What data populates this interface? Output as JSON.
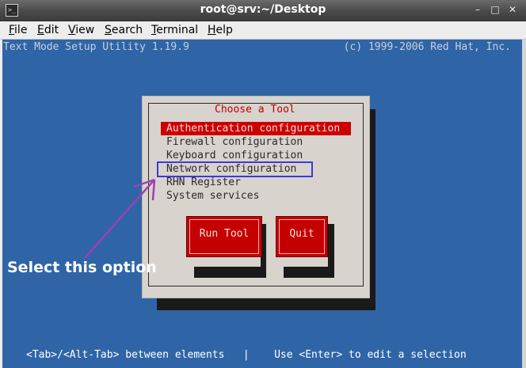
{
  "window": {
    "title": "root@srv:~/Desktop"
  },
  "menubar": {
    "items": [
      {
        "mnemonic": "F",
        "rest": "ile"
      },
      {
        "mnemonic": "E",
        "rest": "dit"
      },
      {
        "mnemonic": "V",
        "rest": "iew"
      },
      {
        "mnemonic": "S",
        "rest": "earch"
      },
      {
        "mnemonic": "T",
        "rest": "erminal"
      },
      {
        "mnemonic": "H",
        "rest": "elp"
      }
    ]
  },
  "terminal": {
    "header_left": "Text Mode Setup Utility 1.19.9",
    "header_right": "(c) 1999-2006 Red Hat, Inc.",
    "footer": "<Tab>/<Alt-Tab> between elements   |    Use <Enter> to edit a selection"
  },
  "dialog": {
    "title": "Choose a Tool",
    "items": [
      "Authentication configuration",
      "Firewall configuration",
      "Keyboard configuration",
      "Network configuration",
      "RHN Register",
      "System services"
    ],
    "selected_item": "Authentication configuration",
    "run_button": "Run Tool",
    "quit_button": "Quit"
  },
  "annotation": {
    "text": "Select this option",
    "highlight_color": "#3b3bd8",
    "arrow_color": "#a040b0"
  },
  "colors": {
    "terminal_bg": "#2f65a6",
    "dialog_bg": "#d8d3cd",
    "accent_red": "#cc0000"
  }
}
